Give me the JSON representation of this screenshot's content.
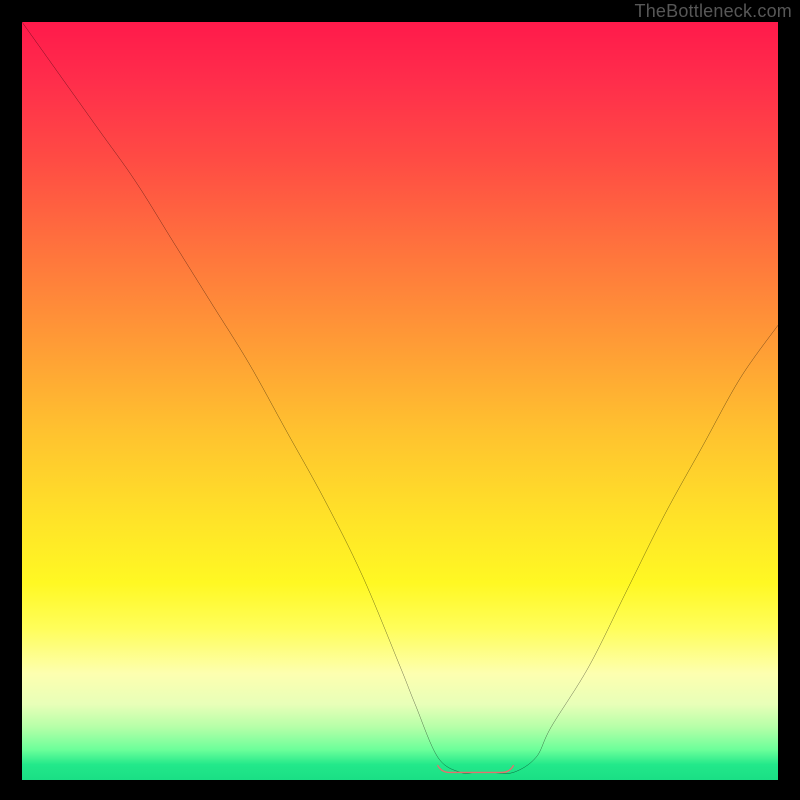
{
  "watermark": "TheBottleneck.com",
  "chart_data": {
    "type": "line",
    "title": "",
    "xlabel": "",
    "ylabel": "",
    "xlim": [
      0,
      100
    ],
    "ylim": [
      0,
      100
    ],
    "series": [
      {
        "name": "curve",
        "x": [
          0,
          5,
          10,
          15,
          20,
          25,
          30,
          35,
          40,
          45,
          50,
          52,
          55,
          58,
          60,
          62,
          65,
          68,
          70,
          75,
          80,
          85,
          90,
          95,
          100
        ],
        "values": [
          100,
          93,
          86,
          79,
          71,
          63,
          55,
          46,
          37,
          27,
          15,
          10,
          3,
          1,
          1,
          1,
          1,
          3,
          7,
          15,
          25,
          35,
          44,
          53,
          60
        ]
      }
    ],
    "flat_zone": {
      "x_start": 55,
      "x_end": 65,
      "y": 1
    },
    "colors": {
      "curve": "#000000",
      "flat_highlight": "#e4716e",
      "gradient_top": "#ff1a4b",
      "gradient_bottom": "#1adf85"
    }
  }
}
